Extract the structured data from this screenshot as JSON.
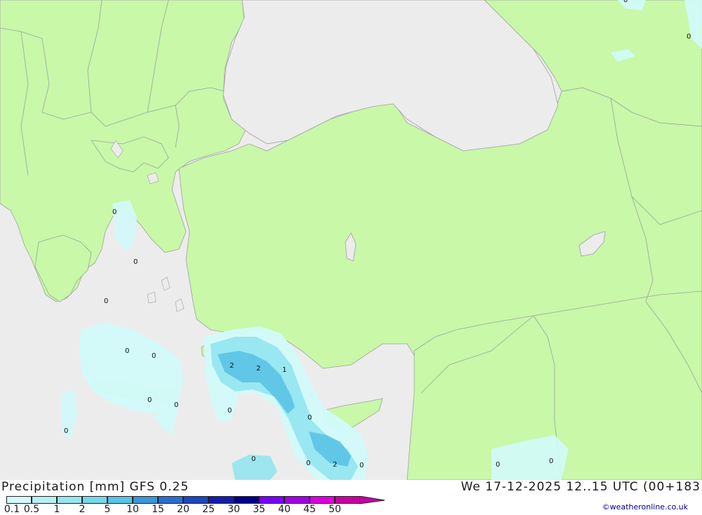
{
  "header": {
    "title": "Precipitation [mm] GFS 0.25",
    "valid_time": "We 17-12-2025 12..15 UTC (00+183",
    "credit": "©weatheronline.co.uk"
  },
  "legend": {
    "labels": [
      "0.1",
      "0.5",
      "1",
      "2",
      "5",
      "10",
      "15",
      "20",
      "25",
      "30",
      "35",
      "40",
      "45",
      "50"
    ],
    "colors": [
      "#d2fafa",
      "#b4f0f5",
      "#96e6f0",
      "#78d7eb",
      "#5ac3e6",
      "#3c96d7",
      "#2a6ecc",
      "#1e46be",
      "#141eaa",
      "#00008c",
      "#7800ff",
      "#a000e6",
      "#dc00dc",
      "#c800a0"
    ]
  },
  "map_values": [
    "0",
    "0",
    "0",
    "0",
    "0",
    "0",
    "0",
    "0",
    "2",
    "2",
    "1",
    "0",
    "0",
    "0",
    "0",
    "2",
    "0",
    "0",
    "0",
    "0",
    "0"
  ],
  "colors": {
    "sea": "#ececec",
    "land": "#c8f8a8",
    "border": "#a0a0a0"
  }
}
